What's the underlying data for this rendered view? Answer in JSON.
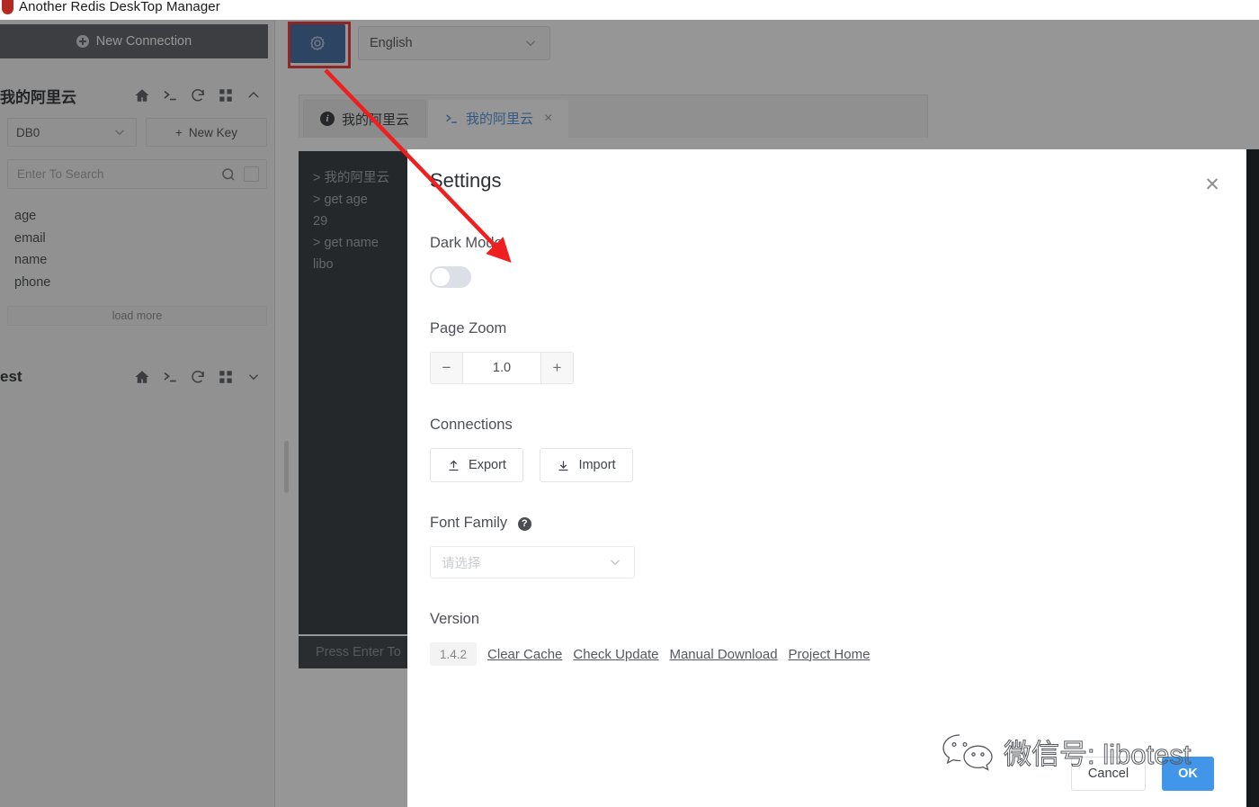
{
  "window": {
    "title": "Another Redis DeskTop Manager"
  },
  "toolbar": {
    "settings_icon": "gear-icon",
    "language": "English",
    "chevron": "chevron-down-icon"
  },
  "sidebar": {
    "new_connection": "New Connection",
    "connections": [
      {
        "name": "我的阿里云",
        "icons": [
          "home-icon",
          "terminal-icon",
          "refresh-icon",
          "grid-icon",
          "chevron-up-icon"
        ],
        "db": "DB0",
        "new_key": "New Key",
        "search_placeholder": "Enter To Search",
        "keys": [
          "age",
          "email",
          "name",
          "phone"
        ],
        "load_more": "load more"
      },
      {
        "name": "est",
        "icons": [
          "home-icon",
          "terminal-icon",
          "refresh-icon",
          "grid-icon",
          "chevron-down-icon"
        ]
      }
    ]
  },
  "tabs": [
    {
      "label": "我的阿里云",
      "icon": "info-icon",
      "active": false,
      "closable": false
    },
    {
      "label": "我的阿里云",
      "icon": "terminal-icon",
      "active": true,
      "closable": true,
      "close": "×"
    }
  ],
  "console": {
    "lines": [
      "> 我的阿里云",
      "> get  age",
      "29",
      "> get name",
      "libo"
    ],
    "input_placeholder": "Press Enter To"
  },
  "dialog": {
    "title": "Settings",
    "close": "✕",
    "dark_mode": {
      "label": "Dark Mode",
      "enabled": false
    },
    "page_zoom": {
      "label": "Page Zoom",
      "value": "1.0",
      "minus": "−",
      "plus": "+"
    },
    "connections": {
      "label": "Connections",
      "export": "Export",
      "import": "Import",
      "export_icon": "upload-icon",
      "import_icon": "download-icon"
    },
    "font_family": {
      "label": "Font Family",
      "help_icon": "question-mark-icon",
      "help_glyph": "?",
      "placeholder": "请选择"
    },
    "version": {
      "label": "Version",
      "number": "1.4.2",
      "links": [
        "Clear Cache",
        "Check Update",
        "Manual Download",
        "Project Home"
      ]
    },
    "cancel": "Cancel",
    "ok": "OK"
  },
  "watermark": {
    "text": "微信号: libotest",
    "logo": "wechat-icon"
  },
  "colors": {
    "accent_blue": "#4296ea",
    "gear_button_blue": "#2c5d97",
    "highlight_red": "#f01f1f",
    "console_bg": "#1d2227",
    "tab_active_text": "#3e85d6"
  }
}
